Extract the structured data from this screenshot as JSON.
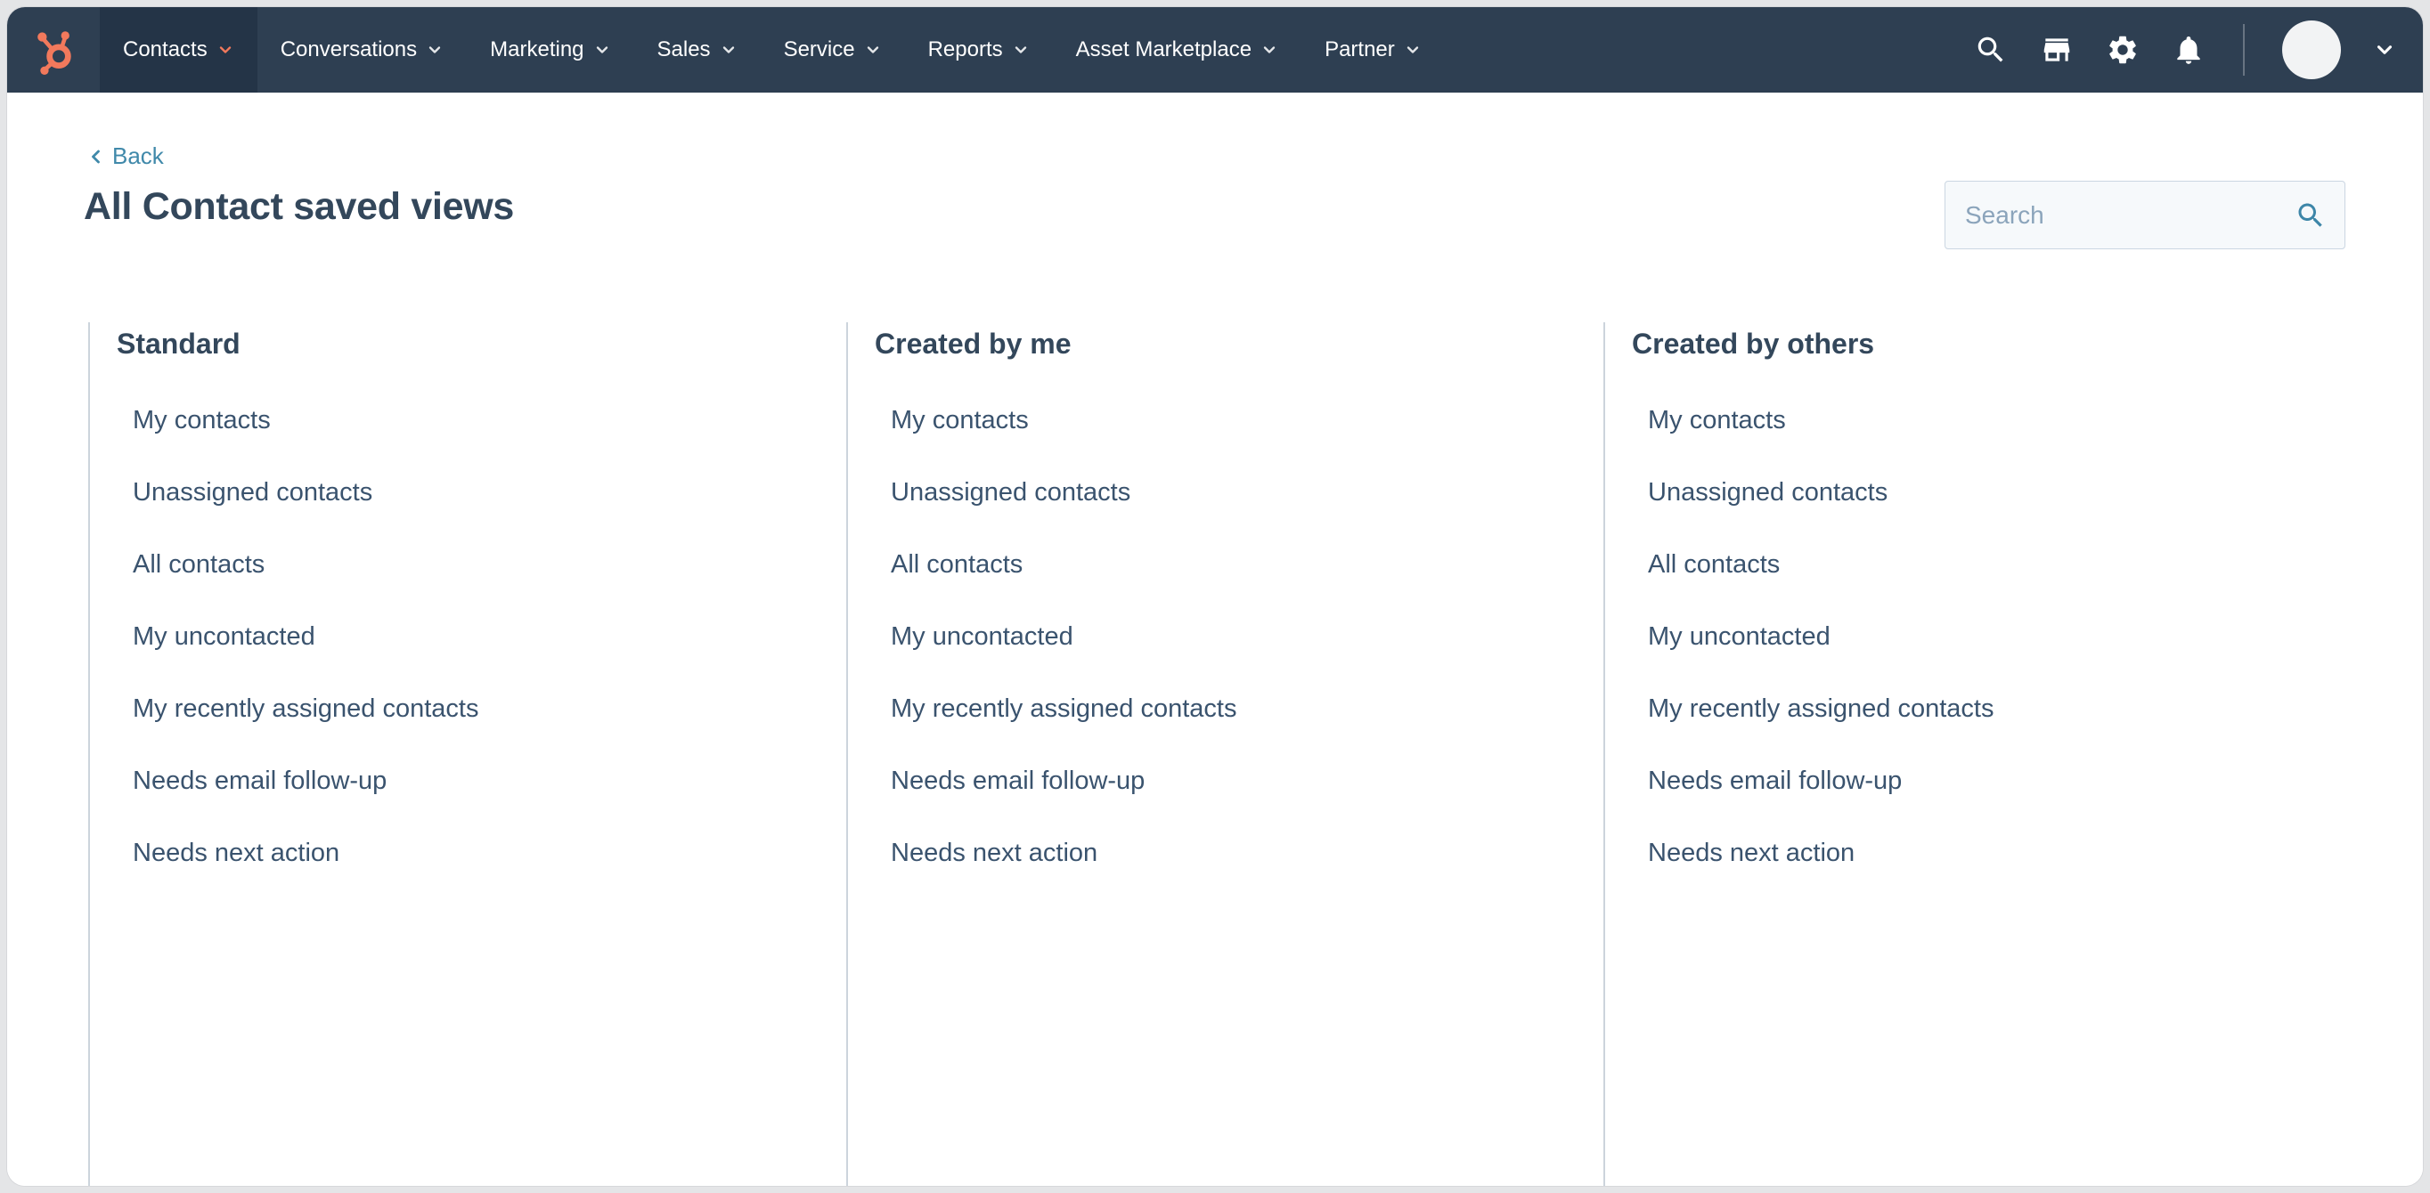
{
  "app": {
    "logo_icon": "hubspot-sprocket-logo"
  },
  "nav": {
    "items": [
      {
        "label": "Contacts",
        "active": true
      },
      {
        "label": "Conversations",
        "active": false
      },
      {
        "label": "Marketing",
        "active": false
      },
      {
        "label": "Sales",
        "active": false
      },
      {
        "label": "Service",
        "active": false
      },
      {
        "label": "Reports",
        "active": false
      },
      {
        "label": "Asset Marketplace",
        "active": false
      },
      {
        "label": "Partner",
        "active": false
      }
    ],
    "action_icons": [
      "search-icon",
      "marketplace-icon",
      "settings-icon",
      "notifications-icon"
    ],
    "user_menu": {
      "avatar": "blank-circle",
      "chevron": "chevron-down-icon"
    }
  },
  "header": {
    "back_label": "Back",
    "title": "All Contact saved views",
    "search": {
      "placeholder": "Search",
      "value": ""
    }
  },
  "columns": [
    {
      "heading": "Standard",
      "items": [
        "My contacts",
        "Unassigned contacts",
        "All contacts",
        "My uncontacted",
        "My recently assigned contacts",
        "Needs email follow-up",
        "Needs next action"
      ]
    },
    {
      "heading": "Created by me",
      "items": [
        "My contacts",
        "Unassigned contacts",
        "All contacts",
        "My uncontacted",
        "My recently assigned contacts",
        "Needs email follow-up",
        "Needs next action"
      ]
    },
    {
      "heading": "Created by others",
      "items": [
        "My contacts",
        "Unassigned contacts",
        "All contacts",
        "My uncontacted",
        "My recently assigned contacts",
        "Needs email follow-up",
        "Needs next action"
      ]
    }
  ],
  "colors": {
    "brand_orange": "#f2795c",
    "nav_background": "#2e3f52",
    "nav_active_background": "#243447",
    "link_teal": "#4089aa",
    "heading_text": "#33475b",
    "column_divider": "#ccd4dc"
  }
}
